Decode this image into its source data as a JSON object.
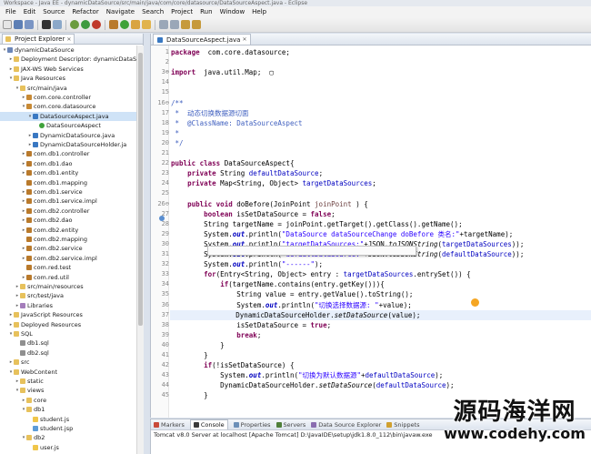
{
  "title_bar": "Workspace - Java EE - dynamicDataSource/src/main/java/com/core/datasource/DataSourceAspect.java - Eclipse",
  "menu": [
    "File",
    "Edit",
    "Source",
    "Refactor",
    "Navigate",
    "Search",
    "Project",
    "Run",
    "Window",
    "Help"
  ],
  "explorer": {
    "tab_label": "Project Explorer",
    "items": [
      {
        "label": "dynamicDataSource",
        "indent": 0,
        "arrow": "▾",
        "icon": "proj"
      },
      {
        "label": "Deployment Descriptor: dynamicDataSo",
        "indent": 1,
        "arrow": "▸",
        "icon": "fold"
      },
      {
        "label": "JAX-WS Web Services",
        "indent": 1,
        "arrow": "▸",
        "icon": "fold"
      },
      {
        "label": "Java Resources",
        "indent": 1,
        "arrow": "▾",
        "icon": "fold"
      },
      {
        "label": "src/main/java",
        "indent": 2,
        "arrow": "▾",
        "icon": "fold"
      },
      {
        "label": "com.core.controller",
        "indent": 3,
        "arrow": "▸",
        "icon": "pkgcore"
      },
      {
        "label": "com.core.datasource",
        "indent": 3,
        "arrow": "▾",
        "icon": "pkgcore"
      },
      {
        "label": "DataSourceAspect.java",
        "indent": 4,
        "arrow": "▾",
        "icon": "java",
        "selected": true
      },
      {
        "label": "DataSourceAspect",
        "indent": 5,
        "arrow": "",
        "icon": "cls"
      },
      {
        "label": "DynamicDataSource.java",
        "indent": 4,
        "arrow": "▸",
        "icon": "java"
      },
      {
        "label": "DynamicDataSourceHolder.ja",
        "indent": 4,
        "arrow": "▸",
        "icon": "java"
      },
      {
        "label": "com.db1.controller",
        "indent": 3,
        "arrow": "▸",
        "icon": "pkg"
      },
      {
        "label": "com.db1.dao",
        "indent": 3,
        "arrow": "▸",
        "icon": "pkg"
      },
      {
        "label": "com.db1.entity",
        "indent": 3,
        "arrow": "▸",
        "icon": "pkg"
      },
      {
        "label": "com.db1.mapping",
        "indent": 3,
        "arrow": "",
        "icon": "pkg"
      },
      {
        "label": "com.db1.service",
        "indent": 3,
        "arrow": "▸",
        "icon": "pkg"
      },
      {
        "label": "com.db1.service.impl",
        "indent": 3,
        "arrow": "▸",
        "icon": "pkg"
      },
      {
        "label": "com.db2.controller",
        "indent": 3,
        "arrow": "▸",
        "icon": "pkg"
      },
      {
        "label": "com.db2.dao",
        "indent": 3,
        "arrow": "▸",
        "icon": "pkg"
      },
      {
        "label": "com.db2.entity",
        "indent": 3,
        "arrow": "▸",
        "icon": "pkg"
      },
      {
        "label": "com.db2.mapping",
        "indent": 3,
        "arrow": "",
        "icon": "pkg"
      },
      {
        "label": "com.db2.service",
        "indent": 3,
        "arrow": "▸",
        "icon": "pkg"
      },
      {
        "label": "com.db2.service.impl",
        "indent": 3,
        "arrow": "▸",
        "icon": "pkg"
      },
      {
        "label": "com.red.test",
        "indent": 3,
        "arrow": "",
        "icon": "pkg"
      },
      {
        "label": "com.red.util",
        "indent": 3,
        "arrow": "▸",
        "icon": "pkg"
      },
      {
        "label": "src/main/resources",
        "indent": 2,
        "arrow": "▸",
        "icon": "fold"
      },
      {
        "label": "src/test/java",
        "indent": 2,
        "arrow": "▸",
        "icon": "fold"
      },
      {
        "label": "Libraries",
        "indent": 2,
        "arrow": "▸",
        "icon": "lib"
      },
      {
        "label": "JavaScript Resources",
        "indent": 1,
        "arrow": "▸",
        "icon": "fold"
      },
      {
        "label": "Deployed Resources",
        "indent": 1,
        "arrow": "▸",
        "icon": "fold"
      },
      {
        "label": "SQL",
        "indent": 1,
        "arrow": "▾",
        "icon": "fold"
      },
      {
        "label": "db1.sql",
        "indent": 2,
        "arrow": "",
        "icon": "sql"
      },
      {
        "label": "db2.sql",
        "indent": 2,
        "arrow": "",
        "icon": "sql"
      },
      {
        "label": "src",
        "indent": 1,
        "arrow": "▸",
        "icon": "fold"
      },
      {
        "label": "WebContent",
        "indent": 1,
        "arrow": "▾",
        "icon": "fold"
      },
      {
        "label": "static",
        "indent": 2,
        "arrow": "▸",
        "icon": "fold"
      },
      {
        "label": "views",
        "indent": 2,
        "arrow": "▾",
        "icon": "fold"
      },
      {
        "label": "core",
        "indent": 3,
        "arrow": "▸",
        "icon": "fold"
      },
      {
        "label": "db1",
        "indent": 3,
        "arrow": "▾",
        "icon": "fold"
      },
      {
        "label": "student.js",
        "indent": 4,
        "arrow": "",
        "icon": "js"
      },
      {
        "label": "student.jsp",
        "indent": 4,
        "arrow": "",
        "icon": "jsp"
      },
      {
        "label": "db2",
        "indent": 3,
        "arrow": "▾",
        "icon": "fold"
      },
      {
        "label": "user.js",
        "indent": 4,
        "arrow": "",
        "icon": "js"
      }
    ]
  },
  "editor": {
    "tab_label": "DataSourceAspect.java",
    "line_numbers": [
      "1",
      "2",
      "3",
      "",
      "",
      "",
      "",
      "",
      "",
      "",
      "",
      "",
      "",
      "",
      "",
      "",
      "",
      "",
      "",
      "",
      "",
      "",
      "",
      "",
      "",
      "",
      "",
      "",
      "",
      "",
      "",
      "",
      "",
      "",
      "",
      "",
      ""
    ],
    "lines": [
      {
        "n": "1",
        "t": [
          [
            "kw",
            "package"
          ],
          [
            "",
            "  com.core.datasource;"
          ]
        ]
      },
      {
        "n": "2",
        "t": []
      },
      {
        "n": "3⊕",
        "t": [
          [
            "kw",
            "import"
          ],
          [
            "",
            "  java.util.Map;  ▢"
          ]
        ]
      },
      {
        "n": "14",
        "t": []
      },
      {
        "n": "15",
        "t": []
      },
      {
        "n": "16⊖",
        "t": [
          [
            "jd",
            "/**"
          ]
        ]
      },
      {
        "n": "17",
        "t": [
          [
            "jd",
            " *  动态切换数据源切面"
          ]
        ]
      },
      {
        "n": "18",
        "t": [
          [
            "jd",
            " *  @ClassName: DataSourceAspect"
          ]
        ]
      },
      {
        "n": "19",
        "t": [
          [
            "jd",
            " *"
          ]
        ]
      },
      {
        "n": "20",
        "t": [
          [
            "jd",
            " */"
          ]
        ]
      },
      {
        "n": "21",
        "t": []
      },
      {
        "n": "22",
        "t": [
          [
            "kw",
            "public class"
          ],
          [
            "",
            " DataSourceAspect{"
          ]
        ]
      },
      {
        "n": "23",
        "t": [
          [
            "",
            "    "
          ],
          [
            "kw",
            "private"
          ],
          [
            "",
            " String "
          ],
          [
            "fld",
            "defaultDataSource"
          ],
          [
            "",
            ";"
          ]
        ]
      },
      {
        "n": "24",
        "t": [
          [
            "",
            "    "
          ],
          [
            "kw",
            "private"
          ],
          [
            "",
            " Map<String, Object> "
          ],
          [
            "fld",
            "targetDataSources"
          ],
          [
            "",
            ";"
          ]
        ]
      },
      {
        "n": "25",
        "t": []
      },
      {
        "n": "26⊖",
        "t": [
          [
            "",
            "    "
          ],
          [
            "kw",
            "public void"
          ],
          [
            "",
            " doBefore(JoinPoint "
          ],
          [
            "var",
            "joinPoint"
          ],
          [
            "",
            " ) {"
          ]
        ]
      },
      {
        "n": "27",
        "t": [
          [
            "",
            "        "
          ],
          [
            "kw",
            "boolean"
          ],
          [
            "",
            " isSetDataSource = "
          ],
          [
            "kw",
            "false"
          ],
          [
            "",
            ";"
          ]
        ]
      },
      {
        "n": "28",
        "t": [
          [
            "",
            "        String targetName = joinPoint.getTarget().getClass().getName();"
          ]
        ]
      },
      {
        "n": "29",
        "t": [
          [
            "",
            "        System."
          ],
          [
            "sfld",
            "out"
          ],
          [
            "",
            ".println("
          ],
          [
            "str",
            "\"DataSource dataSourceChange doBefore 类名:\""
          ],
          [
            "",
            "+targetName);"
          ]
        ]
      },
      {
        "n": "30",
        "t": [
          [
            "",
            "        System."
          ],
          [
            "sfld",
            "out"
          ],
          [
            "",
            ".println("
          ],
          [
            "str",
            "\"targetDataSources:\""
          ],
          [
            "",
            "+JSON."
          ],
          [
            "it",
            "toJSONString"
          ],
          [
            "",
            "("
          ],
          [
            "fld",
            "targetDataSources"
          ],
          [
            "",
            "));"
          ]
        ]
      },
      {
        "n": "31",
        "t": [
          [
            "",
            "        System."
          ],
          [
            "sfld",
            "out"
          ],
          [
            "",
            ".println("
          ],
          [
            "str",
            "\"defaultDataSource:\""
          ],
          [
            "",
            "+JSON."
          ],
          [
            "it",
            "toJSONString"
          ],
          [
            "",
            "("
          ],
          [
            "fld",
            "defaultDataSource"
          ],
          [
            "",
            "));"
          ]
        ]
      },
      {
        "n": "32",
        "t": [
          [
            "",
            "        System."
          ],
          [
            "sfld",
            "out"
          ],
          [
            "",
            ".println("
          ],
          [
            "str",
            "\"------\""
          ],
          [
            "",
            ");"
          ]
        ]
      },
      {
        "n": "33",
        "t": [
          [
            "",
            "        "
          ],
          [
            "kw",
            "for"
          ],
          [
            "",
            "(Entry<String, Object> entry : "
          ],
          [
            "fld",
            "targetDataSources"
          ],
          [
            "",
            ".entrySet()) {"
          ]
        ]
      },
      {
        "n": "34",
        "t": [
          [
            "",
            "            "
          ],
          [
            "kw",
            "if"
          ],
          [
            "",
            "(targetName.contains(entry.getKey())){"
          ]
        ]
      },
      {
        "n": "35",
        "t": [
          [
            "",
            "                String value = entry.getValue().toString();"
          ]
        ]
      },
      {
        "n": "36",
        "t": [
          [
            "",
            "                System."
          ],
          [
            "sfld",
            "out"
          ],
          [
            "",
            ".println("
          ],
          [
            "str",
            "\"切换选择数据源: \""
          ],
          [
            "",
            "+value);"
          ]
        ]
      },
      {
        "n": "37",
        "t": [
          [
            "",
            "                DynamicDataSourceHolder."
          ],
          [
            "it",
            "setDataSource"
          ],
          [
            "",
            "(value);"
          ]
        ],
        "hl": true
      },
      {
        "n": "38",
        "t": [
          [
            "",
            "                isSetDataSource = "
          ],
          [
            "kw",
            "true"
          ],
          [
            "",
            ";"
          ]
        ]
      },
      {
        "n": "39",
        "t": [
          [
            "",
            "                "
          ],
          [
            "kw",
            "break"
          ],
          [
            "",
            ";"
          ]
        ]
      },
      {
        "n": "40",
        "t": [
          [
            "",
            "            }"
          ]
        ]
      },
      {
        "n": "41",
        "t": [
          [
            "",
            "        }"
          ]
        ]
      },
      {
        "n": "42",
        "t": [
          [
            "",
            "        "
          ],
          [
            "kw",
            "if"
          ],
          [
            "",
            "(!isSetDataSource) {"
          ]
        ]
      },
      {
        "n": "43",
        "t": [
          [
            "",
            "            System."
          ],
          [
            "sfld",
            "out"
          ],
          [
            "",
            ".println("
          ],
          [
            "str",
            "\"切换为默认数据源\""
          ],
          [
            "",
            "+"
          ],
          [
            "fld",
            "defaultDataSource"
          ],
          [
            "",
            ");"
          ]
        ]
      },
      {
        "n": "44",
        "t": [
          [
            "",
            "            DynamicDataSourceHolder."
          ],
          [
            "it",
            "setDataSource"
          ],
          [
            "",
            "("
          ],
          [
            "fld",
            "defaultDataSource"
          ],
          [
            "",
            ");"
          ]
        ]
      },
      {
        "n": "45",
        "t": [
          [
            "",
            "        }"
          ]
        ]
      }
    ]
  },
  "console": {
    "tabs": [
      "Markers",
      "Console",
      "Properties",
      "Servers",
      "Data Source Explorer",
      "Snippets"
    ],
    "active_tab": "Console",
    "status_line": "Tomcat v8.0 Server at localhost [Apache Tomcat] D:\\JavaIDE\\setup\\jdk1.8.0_112\\bin\\javaw.exe"
  },
  "watermark": {
    "line1": "源码海洋网",
    "line2": "www.codehy.com"
  },
  "colors": {
    "keyword": "#7f0055",
    "string": "#2a00ff",
    "javadoc": "#3f5fbf",
    "field": "#0000c0",
    "selection": "#cfe3f7"
  }
}
